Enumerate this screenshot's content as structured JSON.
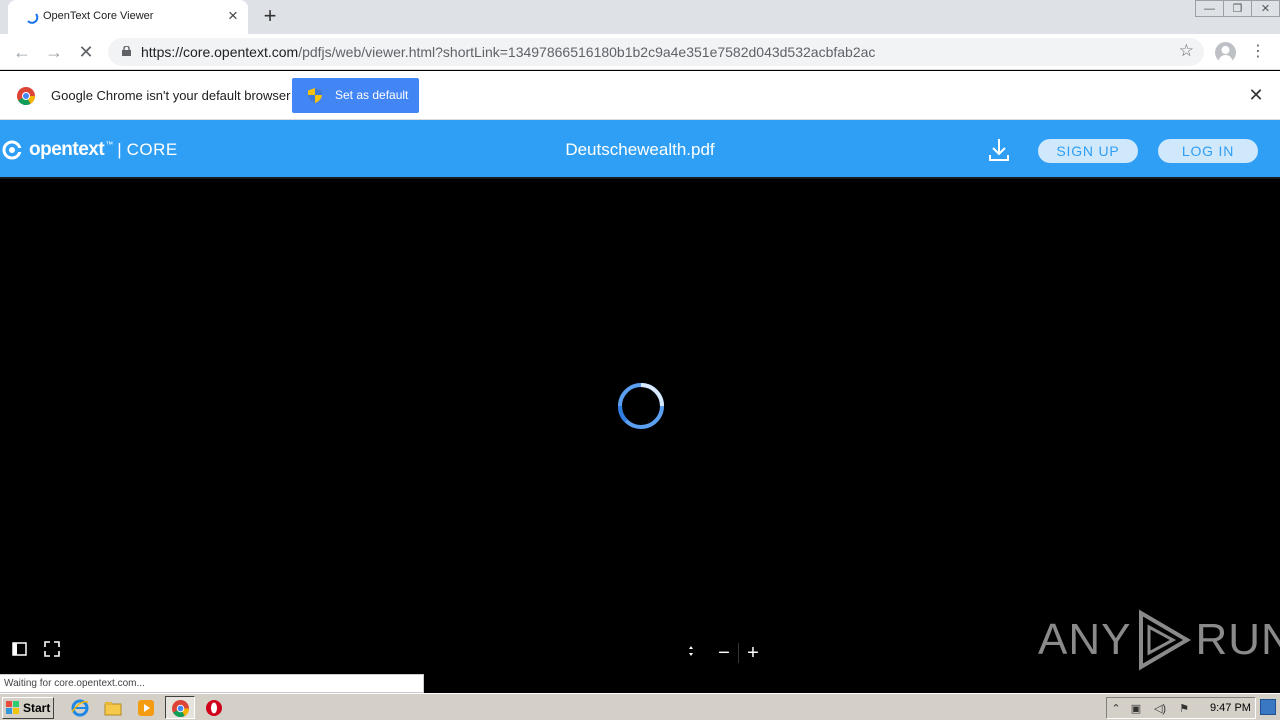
{
  "browser": {
    "tab_title": "OpenText Core Viewer",
    "url_host": "https://core.opentext.com",
    "url_path": "/pdfjs/web/viewer.html?shortLink=13497866516180b1b2c9a4e351e7582d043d532acbfab2ac"
  },
  "infobar": {
    "message": "Google Chrome isn't your default browser",
    "button_label": "Set as default"
  },
  "app": {
    "brand_name": "opentext",
    "brand_tm": "™",
    "brand_sep": "|",
    "brand_product": "CORE",
    "document_name": "Deutschewealth.pdf",
    "sign_up_label": "SIGN UP",
    "log_in_label": "LOG IN",
    "accent_color": "#2f9ff5"
  },
  "viewer": {
    "zoom_out": "−",
    "zoom_in": "+",
    "status_text": "Waiting for core.opentext.com..."
  },
  "watermark": {
    "left": "ANY",
    "right": "RUN"
  },
  "taskbar": {
    "start_label": "Start",
    "clock": "9:47 PM"
  }
}
